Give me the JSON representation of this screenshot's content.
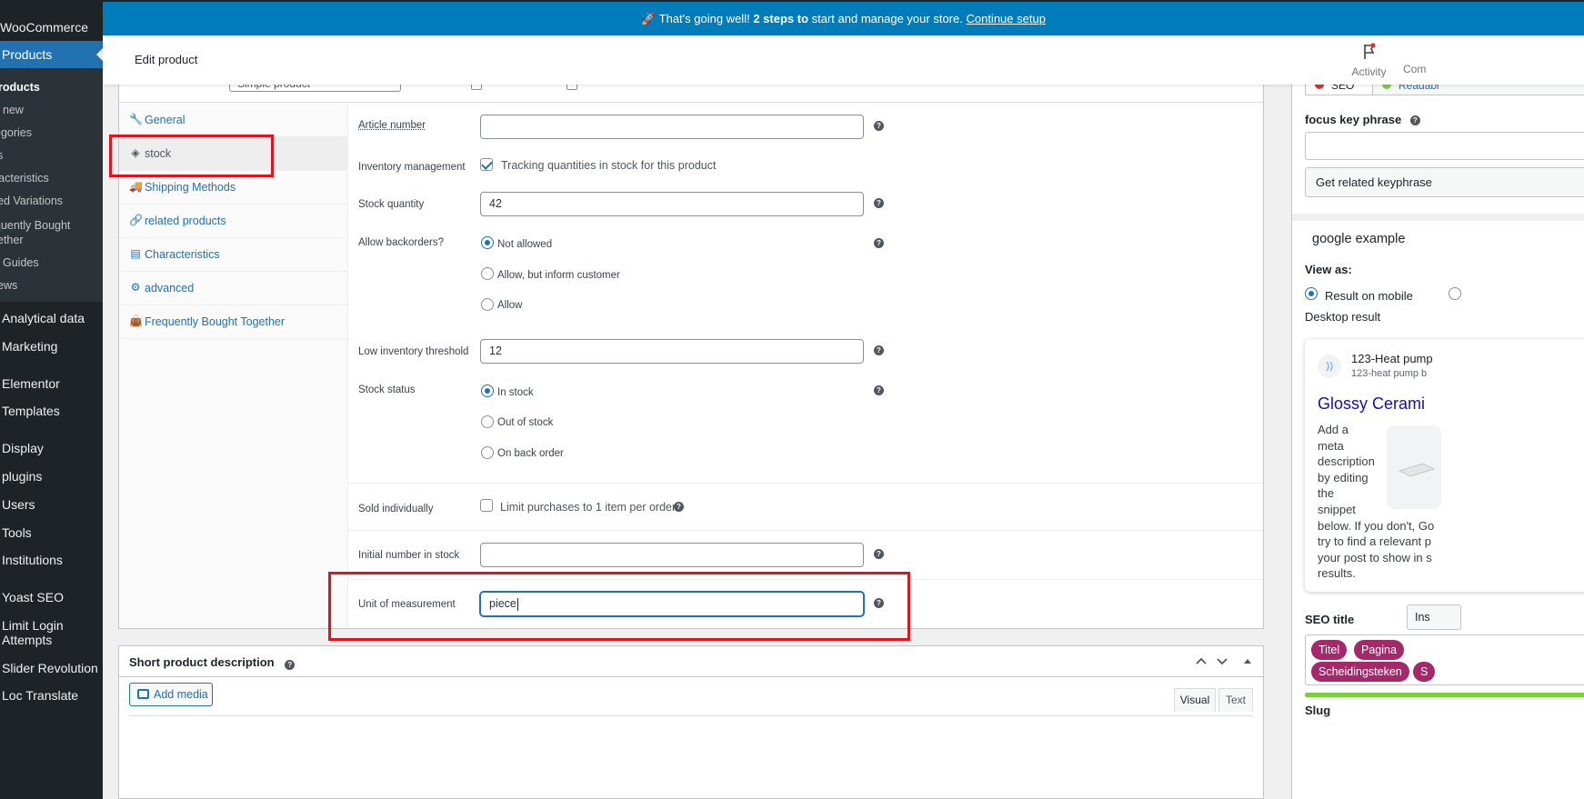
{
  "sidebar": {
    "woocommerce": "WooCommerce",
    "products": "Products",
    "submenu": [
      "roducts",
      "new",
      "egories",
      "s",
      "racteristics",
      "ed Variations",
      "quently Bought",
      "ether",
      "Guides",
      "ews"
    ],
    "items": [
      "Analytical data",
      "Marketing",
      "Elementor",
      "Templates",
      "Display",
      "plugins",
      "Users",
      "Tools",
      "Institutions",
      "Yoast SEO",
      "Limit Login",
      "Attempts",
      "Slider Revolution",
      "Loc Translate"
    ]
  },
  "notice": {
    "icon": "rocket-icon",
    "text": "That's going well!",
    "bold": "2 steps to",
    "rest": "start and manage your store.",
    "link": "Continue setup"
  },
  "header": {
    "title": "Edit product",
    "activity": "Activity",
    "comments": "Com"
  },
  "panel": {
    "type_select": "Simple product",
    "tabs": [
      {
        "label": "General",
        "icon": "wrench-icon"
      },
      {
        "label": "stock",
        "icon": "tag-icon"
      },
      {
        "label": "Shipping Methods",
        "icon": "truck-icon"
      },
      {
        "label": "related products",
        "icon": "link-icon"
      },
      {
        "label": "Characteristics",
        "icon": "table-icon"
      },
      {
        "label": "advanced",
        "icon": "gear-icon"
      },
      {
        "label": "Frequently Bought Together",
        "icon": "bag-icon"
      }
    ],
    "fields": {
      "article_number": {
        "label": "Article number",
        "value": ""
      },
      "inventory_management": {
        "label": "Inventory management",
        "checkbox_label": "Tracking quantities in stock for this product",
        "checked": true
      },
      "stock_quantity": {
        "label": "Stock quantity",
        "value": "42"
      },
      "backorders": {
        "label": "Allow backorders?",
        "options": [
          "Not allowed",
          "Allow, but inform customer",
          "Allow"
        ],
        "selected": "Not allowed"
      },
      "low_threshold": {
        "label": "Low inventory threshold",
        "value": "12"
      },
      "stock_status": {
        "label": "Stock status",
        "options": [
          "In stock",
          "Out of stock",
          "On back order"
        ],
        "selected": "In stock"
      },
      "sold_individually": {
        "label": "Sold individually",
        "checkbox_label": "Limit purchases to 1 item per order",
        "checked": false
      },
      "initial_number": {
        "label": "Initial number in stock",
        "value": ""
      },
      "unit": {
        "label": "Unit of measurement",
        "value": "piece"
      }
    }
  },
  "short_description": {
    "title": "Short product description",
    "add_media": "Add media",
    "visual": "Visual",
    "text": "Text"
  },
  "yoast": {
    "tab_seo": "SEO",
    "tab_readability": "Readabi",
    "focus_label": "focus key phrase",
    "related_btn": "Get related keyphrase",
    "google_example": "google example",
    "view_as": "View as:",
    "mobile_result": "Result on mobile",
    "desktop_result": "Desktop result",
    "snippet_site": "123-Heat pump",
    "snippet_url": "123-heat pump b",
    "snippet_title": "Glossy Cerami",
    "snippet_desc_lines": [
      "Add a",
      "meta",
      "description",
      "by editing",
      "the",
      "snippet"
    ],
    "snippet_desc_full": [
      "below. If you don't, Go",
      "try to find a relevant p",
      "your post to show in s",
      "results."
    ],
    "seo_title_label": "SEO title",
    "insert_btn": "Ins",
    "pills": [
      "Titel",
      "Pagina",
      "Scheidingsteken",
      "S"
    ],
    "slug_label": "Slug"
  },
  "colors": {
    "accent": "#2271b1",
    "sidebar": "#1d2327",
    "notice": "#007cba",
    "highlight": "#e0141e",
    "pill": "#a4286a"
  }
}
